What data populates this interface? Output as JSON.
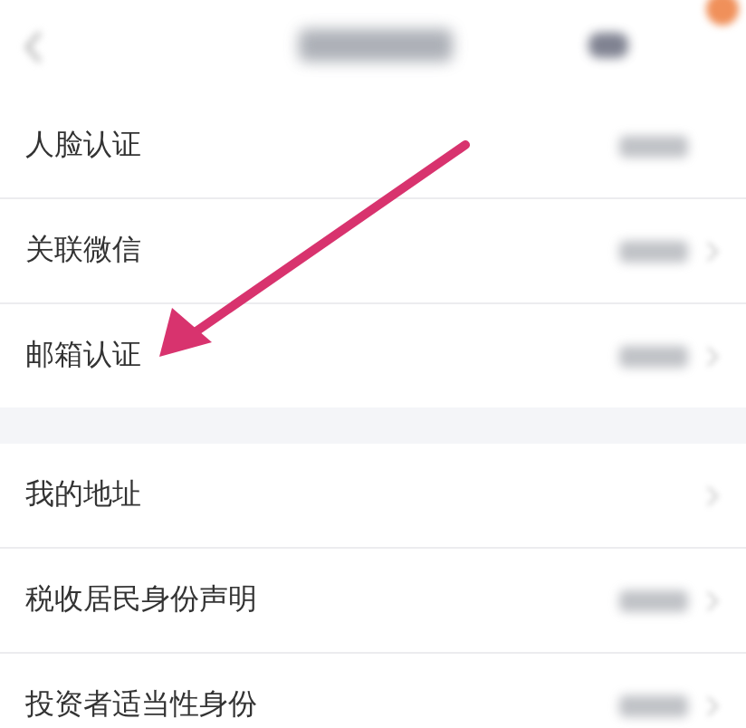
{
  "sections": [
    {
      "rows": [
        {
          "label": "人脸认证",
          "value_shown": true,
          "chevron": false
        },
        {
          "label": "关联微信",
          "value_shown": true,
          "chevron": true
        },
        {
          "label": "邮箱认证",
          "value_shown": true,
          "chevron": true
        }
      ]
    },
    {
      "rows": [
        {
          "label": "我的地址",
          "value_shown": false,
          "chevron": true
        },
        {
          "label": "税收居民身份声明",
          "value_shown": true,
          "chevron": true
        },
        {
          "label": "投资者适当性身份",
          "value_shown": true,
          "chevron": true
        }
      ]
    }
  ]
}
